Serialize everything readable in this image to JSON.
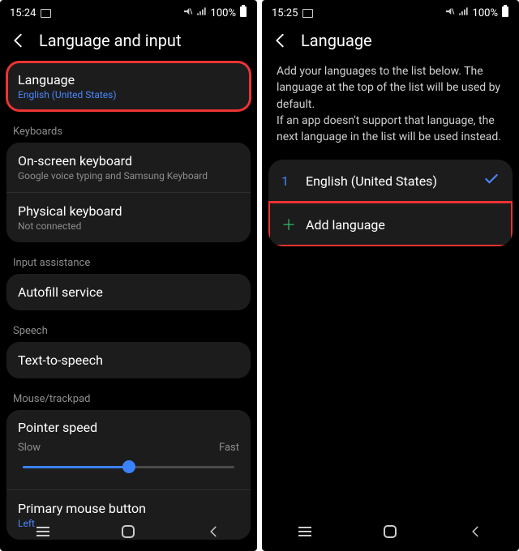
{
  "left": {
    "status": {
      "time": "15:24",
      "battery_pct": "100%"
    },
    "header": {
      "title": "Language and input"
    },
    "language": {
      "title": "Language",
      "subtitle": "English (United States)"
    },
    "sections": {
      "keyboards": "Keyboards",
      "input_assistance": "Input assistance",
      "speech": "Speech",
      "mouse_trackpad": "Mouse/trackpad"
    },
    "onscreen_kb": {
      "title": "On-screen keyboard",
      "subtitle": "Google voice typing and Samsung Keyboard"
    },
    "physical_kb": {
      "title": "Physical keyboard",
      "subtitle": "Not connected"
    },
    "autofill": {
      "title": "Autofill service"
    },
    "tts": {
      "title": "Text-to-speech"
    },
    "pointer": {
      "title": "Pointer speed",
      "slow": "Slow",
      "fast": "Fast",
      "value_pct": 50
    },
    "primary_mouse": {
      "title": "Primary mouse button",
      "subtitle": "Left"
    }
  },
  "right": {
    "status": {
      "time": "15:25",
      "battery_pct": "100%"
    },
    "header": {
      "title": "Language"
    },
    "description": "Add your languages to the list below. The language at the top of the list will be used by default.\nIf an app doesn't support that language, the next language in the list will be used instead.",
    "langs": [
      {
        "index": "1",
        "label": "English (United States)",
        "checked": true
      }
    ],
    "add_label": "Add language"
  }
}
